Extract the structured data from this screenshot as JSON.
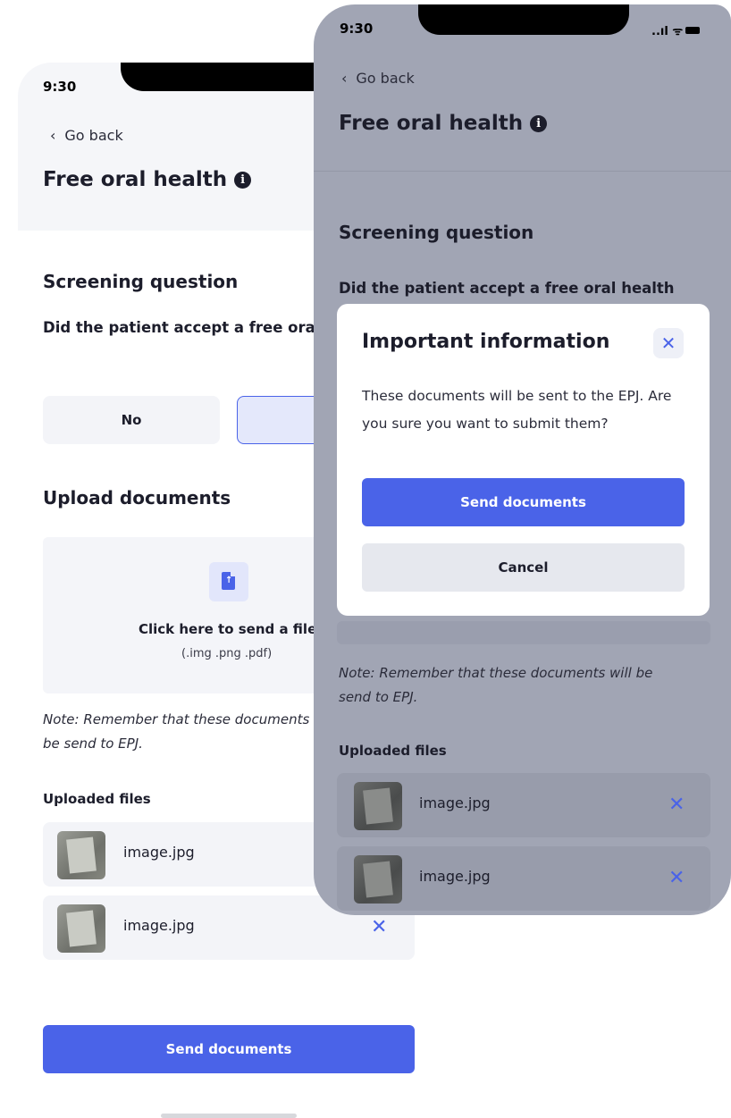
{
  "status_bar": {
    "time": "9:30",
    "icons": "..ıl ᯤ"
  },
  "nav": {
    "back_label": "Go back",
    "chevron": "‹"
  },
  "header": {
    "title": "Free oral health",
    "info_icon": "i"
  },
  "screening": {
    "section_title": "Screening question",
    "question_back": "Did the patient accept a free oral health care?",
    "question_front": "Did the patient accept a free oral health",
    "no_label": "No"
  },
  "upload": {
    "section_title": "Upload documents",
    "cta": "Click here to send a file",
    "types": "(.img .png .pdf)"
  },
  "note": "Note: Remember that these documents will be send to EPJ.",
  "uploaded": {
    "label": "Uploaded files",
    "files": [
      {
        "name": "image.jpg"
      },
      {
        "name": "image.jpg"
      }
    ]
  },
  "actions": {
    "send_label": "Send documents",
    "cancel_label": "Cancel"
  },
  "modal": {
    "title": "Important information",
    "body": "These documents will be sent to the EPJ. Are you sure you want to submit them?",
    "close_glyph": "✕"
  },
  "icons": {
    "remove": "✕"
  },
  "colors": {
    "accent": "#4a63e8",
    "overlay": "#a1a5b4",
    "surface": "#f3f4f8"
  }
}
